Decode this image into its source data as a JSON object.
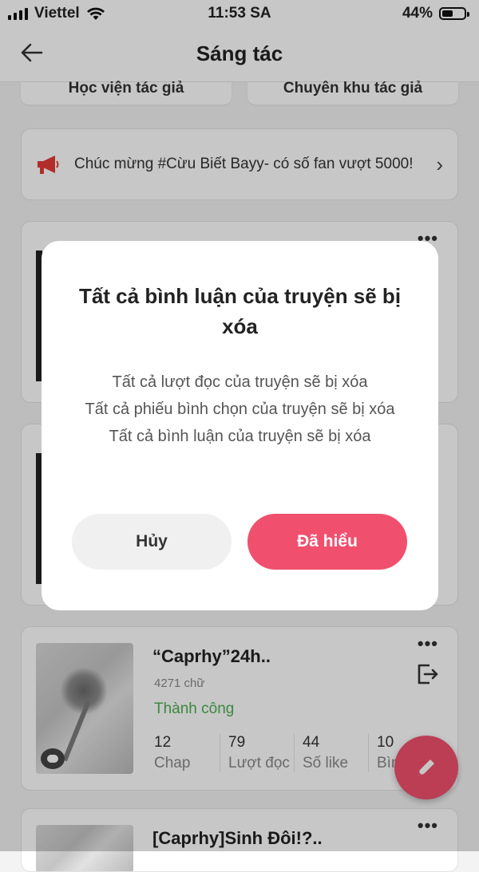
{
  "status_bar": {
    "carrier": "Viettel",
    "time": "11:53 SA",
    "battery": "44%"
  },
  "header": {
    "title": "Sáng tác"
  },
  "top_buttons": {
    "academy": "Học viện tác giả",
    "author_zone": "Chuyên khu tác giả"
  },
  "banner": {
    "text": "Chúc mừng #Cừu Biết Bayy- có số fan vượt 5000!"
  },
  "stories": [
    {
      "title": "“Caprhy”24h..",
      "words": "4271 chữ",
      "status": "Thành công",
      "stats": [
        {
          "value": "12",
          "label": "Chap"
        },
        {
          "value": "79",
          "label": "Lượt đọc"
        },
        {
          "value": "44",
          "label": "Số like"
        },
        {
          "value": "10",
          "label": "Bình l"
        }
      ]
    },
    {
      "title": "[Caprhy]Sinh Đôi!?.."
    }
  ],
  "dialog": {
    "title": "Tất cả bình luận của truyện sẽ bị xóa",
    "line1": "Tất cả lượt đọc của truyện sẽ bị xóa",
    "line2": "Tất cả phiếu bình chọn của truyện sẽ bị xóa",
    "line3": "Tất cả bình luận của truyện sẽ bị xóa",
    "cancel": "Hủy",
    "confirm": "Đã hiểu"
  },
  "colors": {
    "accent": "#f0506e",
    "success": "#4caf50"
  }
}
